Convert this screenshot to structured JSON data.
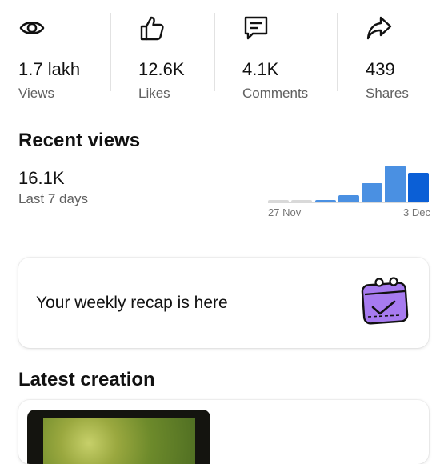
{
  "stats": [
    {
      "icon": "eye-icon",
      "value": "1.7 lakh",
      "label": "Views"
    },
    {
      "icon": "thumbs-up-icon",
      "value": "12.6K",
      "label": "Likes"
    },
    {
      "icon": "comment-icon",
      "value": "4.1K",
      "label": "Comments"
    },
    {
      "icon": "share-icon",
      "value": "439",
      "label": "Shares"
    }
  ],
  "recent_views": {
    "title": "Recent views",
    "value": "16.1K",
    "period": "Last 7 days",
    "start_label": "27 Nov",
    "end_label": "3 Dec",
    "colors": {
      "light": "#4a90e2",
      "dark": "#0b5fd6",
      "faint": "#d9d9d9"
    }
  },
  "recap": {
    "text": "Your weekly recap is here",
    "icon": "calendar-check-icon",
    "accent": "#a77bf0"
  },
  "latest_creation": {
    "title": "Latest creation"
  }
}
